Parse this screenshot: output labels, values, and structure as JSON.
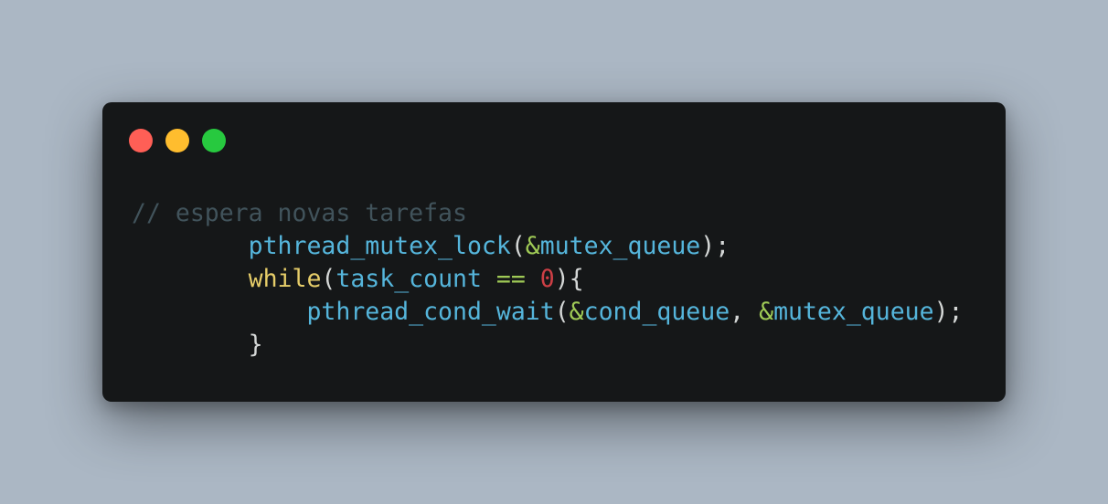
{
  "colors": {
    "background": "#abb7c4",
    "window": "#151718",
    "close": "#ff5f56",
    "minimize": "#ffbd2e",
    "zoom": "#27c93f",
    "comment": "#41535b",
    "function": "#55b5db",
    "operator": "#9fca56",
    "keyword": "#e6cd69",
    "number": "#cd3f45",
    "punctuation": "#d4d7d6"
  },
  "window_controls": {
    "close_icon": "close-dot-icon",
    "minimize_icon": "minimize-dot-icon",
    "zoom_icon": "zoom-dot-icon"
  },
  "code": {
    "language": "c",
    "lines": [
      [
        {
          "type": "comment",
          "text": "// espera novas tarefas"
        }
      ],
      [
        {
          "type": "punc",
          "text": "        "
        },
        {
          "type": "fn",
          "text": "pthread_mutex_lock"
        },
        {
          "type": "punc",
          "text": "("
        },
        {
          "type": "op",
          "text": "&"
        },
        {
          "type": "var",
          "text": "mutex_queue"
        },
        {
          "type": "punc",
          "text": ");"
        }
      ],
      [
        {
          "type": "punc",
          "text": "        "
        },
        {
          "type": "kw",
          "text": "while"
        },
        {
          "type": "punc",
          "text": "("
        },
        {
          "type": "var",
          "text": "task_count"
        },
        {
          "type": "punc",
          "text": " "
        },
        {
          "type": "op",
          "text": "=="
        },
        {
          "type": "punc",
          "text": " "
        },
        {
          "type": "num",
          "text": "0"
        },
        {
          "type": "punc",
          "text": "){"
        }
      ],
      [
        {
          "type": "punc",
          "text": "            "
        },
        {
          "type": "fn",
          "text": "pthread_cond_wait"
        },
        {
          "type": "punc",
          "text": "("
        },
        {
          "type": "op",
          "text": "&"
        },
        {
          "type": "var",
          "text": "cond_queue"
        },
        {
          "type": "punc",
          "text": ", "
        },
        {
          "type": "op",
          "text": "&"
        },
        {
          "type": "var",
          "text": "mutex_queue"
        },
        {
          "type": "punc",
          "text": ");"
        }
      ],
      [
        {
          "type": "punc",
          "text": "        }"
        }
      ]
    ]
  }
}
